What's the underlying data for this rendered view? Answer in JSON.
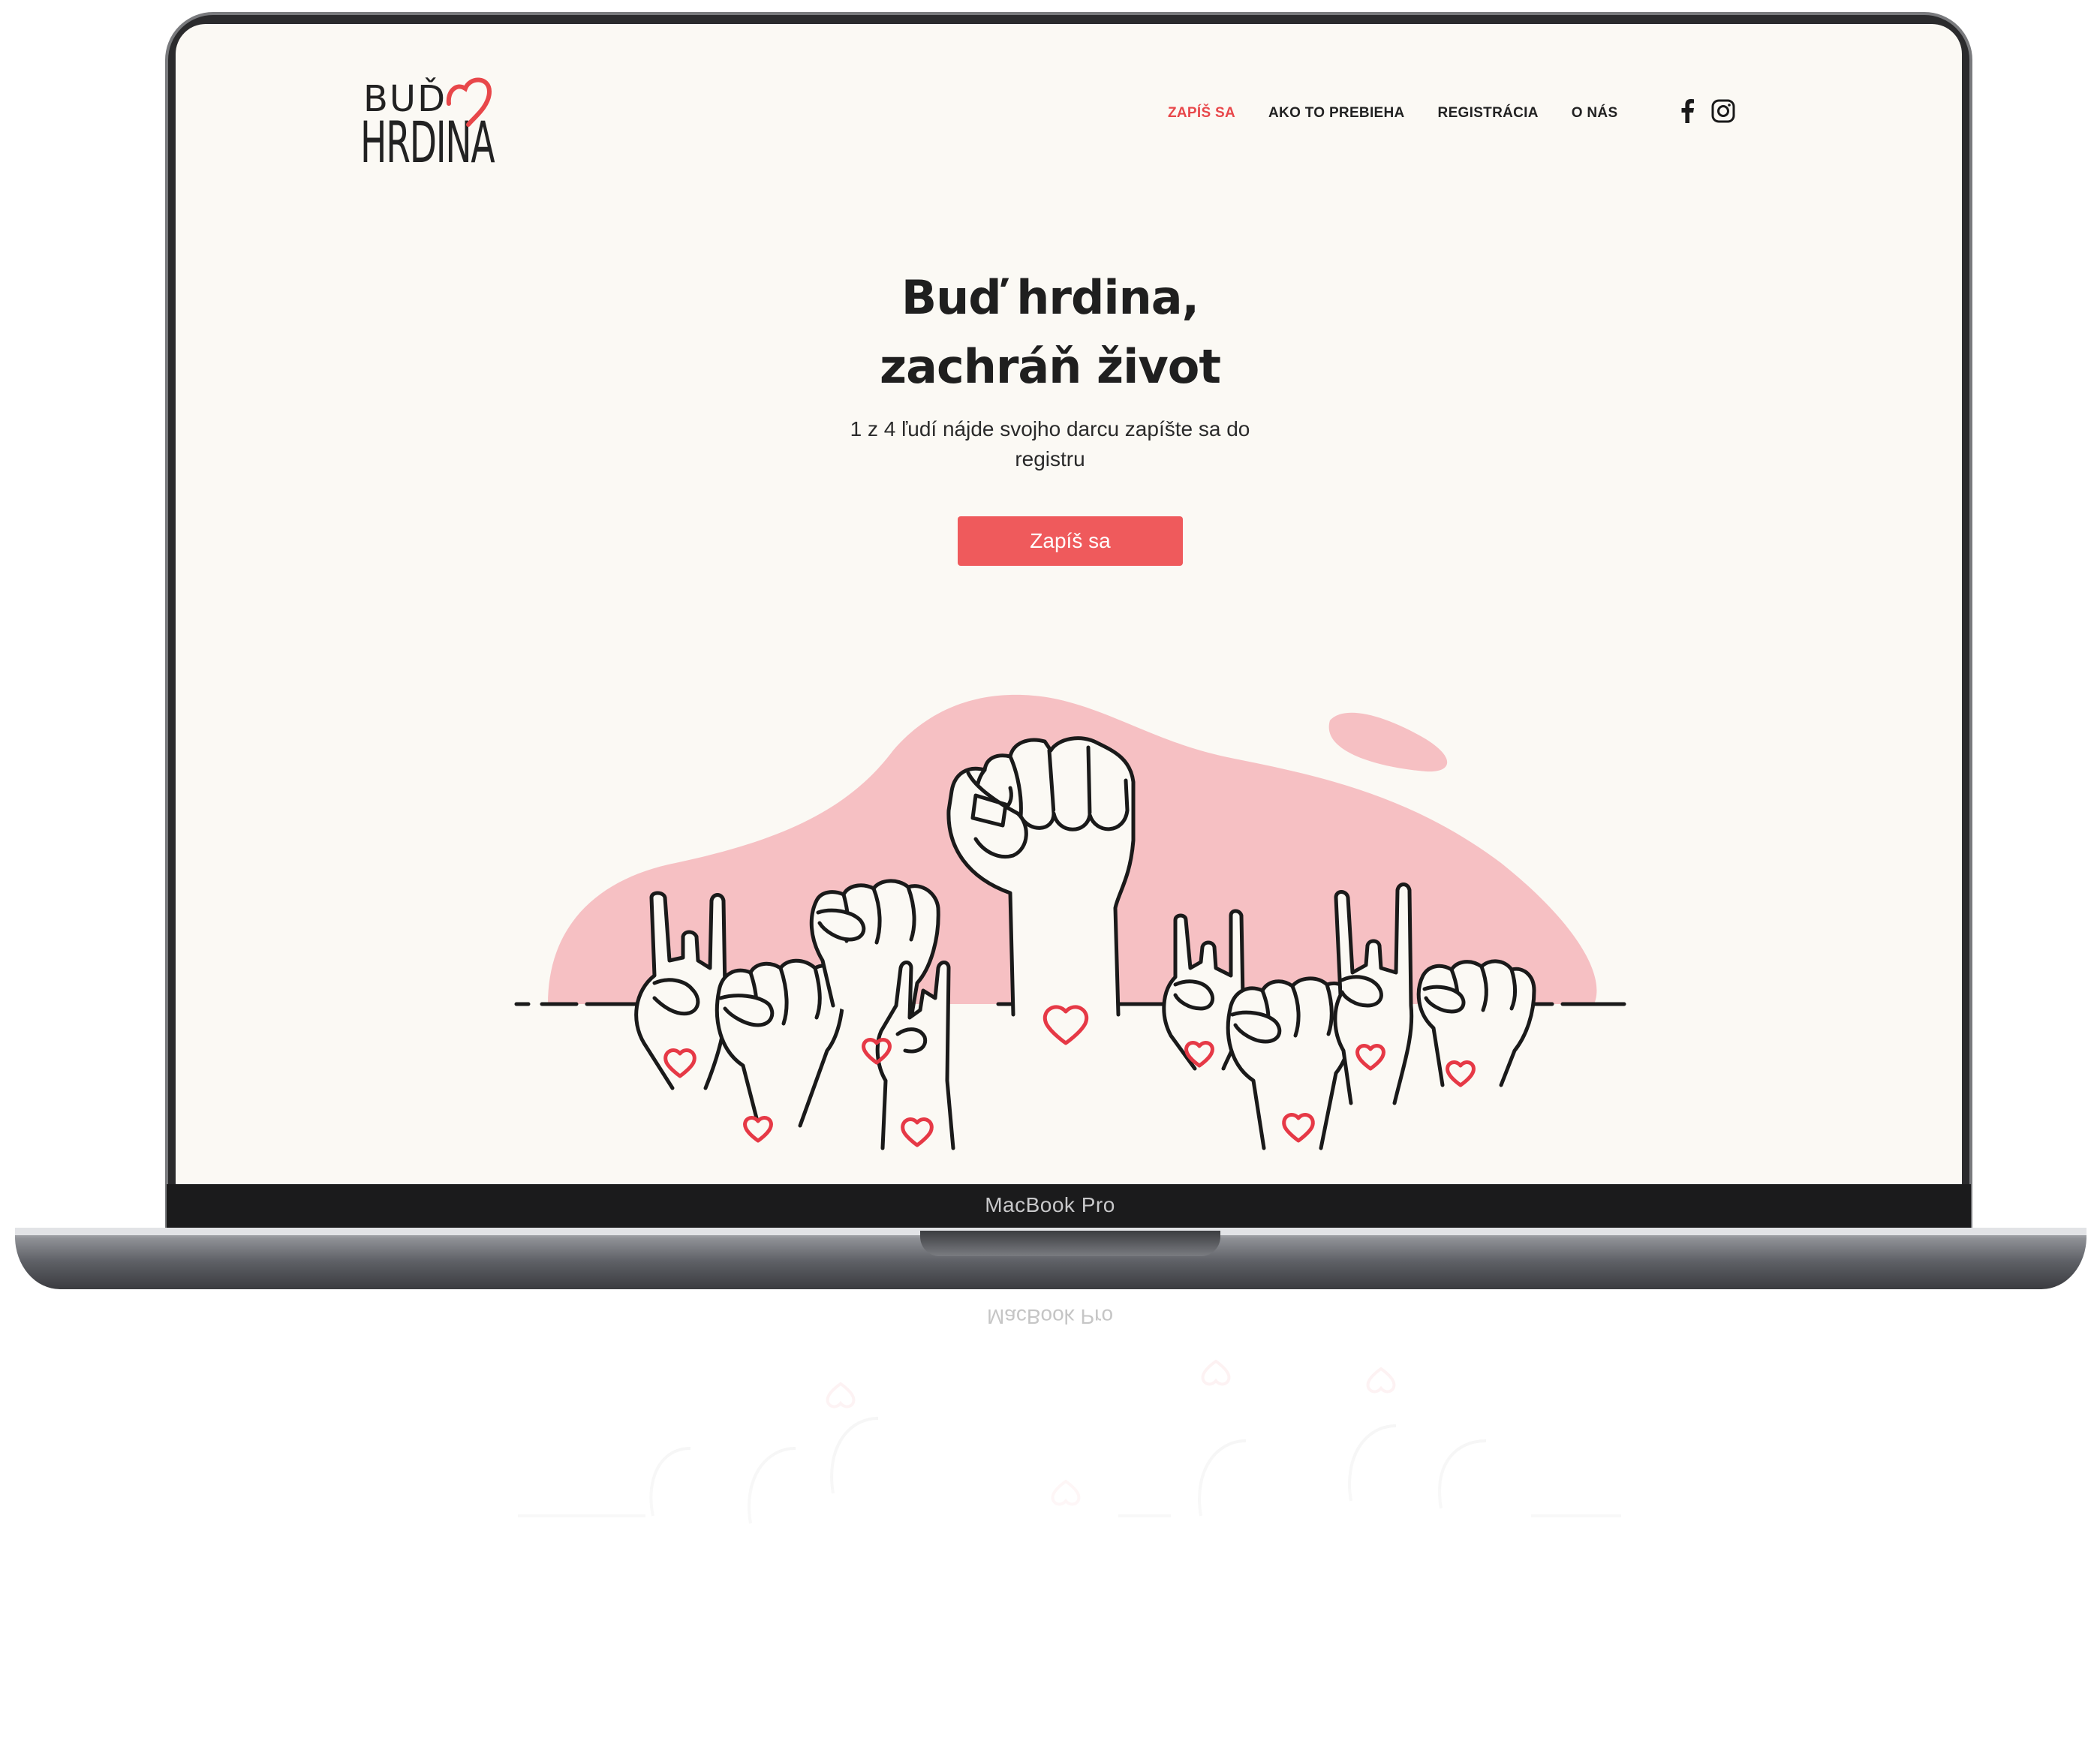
{
  "device": {
    "model_label": "MacBook Pro"
  },
  "site": {
    "logo": {
      "top_text": "BUĎ",
      "bottom_text": "HRDINA"
    },
    "nav": {
      "items": [
        {
          "label": "ZAPÍŠ SA",
          "active": true
        },
        {
          "label": "AKO TO PREBIEHA",
          "active": false
        },
        {
          "label": "REGISTRÁCIA",
          "active": false
        },
        {
          "label": "O NÁS",
          "active": false
        }
      ]
    },
    "social": {
      "icons": [
        "facebook-icon",
        "instagram-icon"
      ]
    },
    "hero": {
      "title_line1": "Buď hrdina,",
      "title_line2": "zachráň život",
      "subtitle": "1 z 4 ľudí nájde svojho darcu zapíšte sa do registru",
      "cta_label": "Zapíš sa"
    },
    "colors": {
      "accent": "#ef5a5c",
      "nav_active": "#e8474a",
      "blob": "#f6c0c3",
      "heart": "#e63946",
      "background": "#fbf9f4",
      "text": "#1f1f1f"
    }
  }
}
